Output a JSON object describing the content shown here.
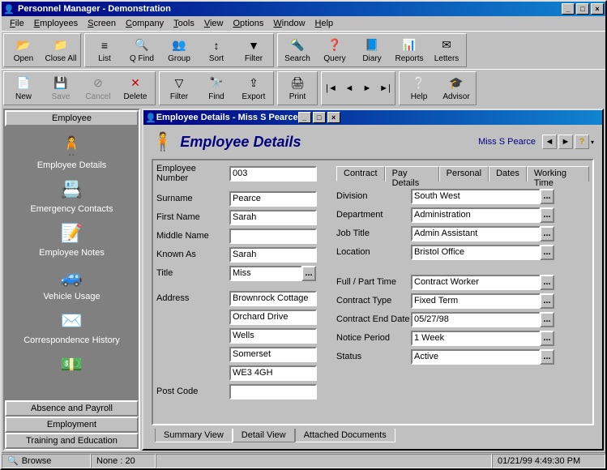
{
  "app": {
    "title": "Personnel Manager - Demonstration"
  },
  "menu": {
    "file": "File",
    "employees": "Employees",
    "screen": "Screen",
    "company": "Company",
    "tools": "Tools",
    "view": "View",
    "options": "Options",
    "window": "Window",
    "help": "Help"
  },
  "toolbar1": {
    "open": "Open",
    "closeall": "Close All",
    "list": "List",
    "qfind": "Q Find",
    "group": "Group",
    "sort": "Sort",
    "filter": "Filter",
    "search": "Search",
    "query": "Query",
    "diary": "Diary",
    "reports": "Reports",
    "letters": "Letters"
  },
  "toolbar2": {
    "new": "New",
    "save": "Save",
    "cancel": "Cancel",
    "delete": "Delete",
    "filter": "Filter",
    "find": "Find",
    "export": "Export",
    "print": "Print",
    "help": "Help",
    "advisor": "Advisor"
  },
  "sidebar": {
    "header": "Employee",
    "items": [
      {
        "label": "Employee Details",
        "icon": "👤"
      },
      {
        "label": "Emergency Contacts",
        "icon": "📇"
      },
      {
        "label": "Employee Notes",
        "icon": "📝"
      },
      {
        "label": "Vehicle Usage",
        "icon": "🚗"
      },
      {
        "label": "Correspondence History",
        "icon": "✉️"
      },
      {
        "label": "",
        "icon": "💰"
      }
    ],
    "footer_btns": [
      "Absence and Payroll",
      "Employment",
      "Training and Education"
    ]
  },
  "child": {
    "title": "Employee Details - Miss S Pearce",
    "heading": "Employee Details",
    "name": "Miss S Pearce",
    "left": {
      "empno_lbl": "Employee Number",
      "empno": "003",
      "surname_lbl": "Surname",
      "surname": "Pearce",
      "first_lbl": "First Name",
      "first": "Sarah",
      "middle_lbl": "Middle Name",
      "middle": "",
      "known_lbl": "Known As",
      "known": "Sarah",
      "title_lbl": "Title",
      "title": "Miss",
      "addr_lbl": "Address",
      "addr1": "Brownrock Cottage",
      "addr2": "Orchard Drive",
      "addr3": "Wells",
      "addr4": "Somerset",
      "addr5": "WE3 4GH",
      "post_lbl": "Post Code",
      "post": ""
    },
    "tabs": [
      "Contract",
      "Pay Details",
      "Personal",
      "Dates",
      "Working Time"
    ],
    "right": {
      "division_lbl": "Division",
      "division": "South West",
      "dept_lbl": "Department",
      "dept": "Administration",
      "job_lbl": "Job Title",
      "job": "Admin Assistant",
      "loc_lbl": "Location",
      "loc": "Bristol Office",
      "fp_lbl": "Full / Part Time",
      "fp": "Contract Worker",
      "ctype_lbl": "Contract Type",
      "ctype": "Fixed Term",
      "cend_lbl": "Contract End Date",
      "cend": "05/27/98",
      "notice_lbl": "Notice Period",
      "notice": "1 Week",
      "status_lbl": "Status",
      "status": "Active"
    },
    "bottom_tabs": [
      "Summary View",
      "Detail View",
      "Attached Documents"
    ]
  },
  "status": {
    "browse": "Browse",
    "count": "None : 20",
    "datetime": "01/21/99 4:49:30 PM"
  }
}
